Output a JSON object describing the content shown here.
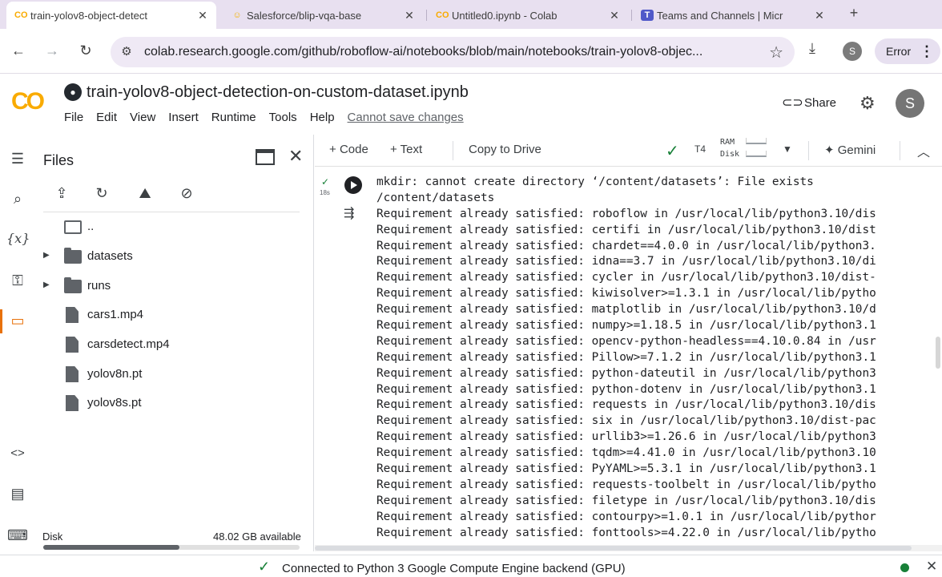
{
  "browser": {
    "tabs": [
      {
        "title": "train-yolov8-object-detect",
        "favicon": "colab-icon",
        "active": true
      },
      {
        "title": "Salesforce/blip-vqa-base",
        "favicon": "huggingface-icon",
        "active": false
      },
      {
        "title": "Untitled0.ipynb - Colab",
        "favicon": "colab-icon",
        "active": false
      },
      {
        "title": "Teams and Channels | Micr",
        "favicon": "teams-icon",
        "active": false
      }
    ],
    "url": "colab.research.google.com/github/roboflow-ai/notebooks/blob/main/notebooks/train-yolov8-objec...",
    "profile_initial": "S",
    "error_label": "Error"
  },
  "colab": {
    "logo_text": "CO",
    "notebook_title": "train-yolov8-object-detection-on-custom-dataset.ipynb",
    "menu": [
      "File",
      "Edit",
      "View",
      "Insert",
      "Runtime",
      "Tools",
      "Help"
    ],
    "unsaved_notice": "Cannot save changes",
    "share_label": "Share",
    "user_initial": "S"
  },
  "files_panel": {
    "title": "Files",
    "items": [
      {
        "name": "..",
        "type": "folder-up",
        "expandable": false
      },
      {
        "name": "datasets",
        "type": "folder",
        "expandable": true
      },
      {
        "name": "runs",
        "type": "folder",
        "expandable": true
      },
      {
        "name": "cars1.mp4",
        "type": "file",
        "expandable": false
      },
      {
        "name": "carsdetect.mp4",
        "type": "file",
        "expandable": false
      },
      {
        "name": "yolov8n.pt",
        "type": "file",
        "expandable": false
      },
      {
        "name": "yolov8s.pt",
        "type": "file",
        "expandable": false
      }
    ],
    "disk_label": "Disk",
    "disk_available": "48.02 GB available",
    "disk_used_fraction": 0.53
  },
  "toolbar": {
    "add_code": "Code",
    "add_text": "Text",
    "copy_to_drive": "Copy to Drive",
    "runtime_type": "T4",
    "ram_label": "RAM",
    "disk_label": "Disk",
    "gemini_label": "Gemini"
  },
  "cell": {
    "exec_time": "18s",
    "output_lines": [
      "mkdir: cannot create directory ‘/content/datasets’: File exists",
      "/content/datasets",
      "Requirement already satisfied: roboflow in /usr/local/lib/python3.10/dis",
      "Requirement already satisfied: certifi in /usr/local/lib/python3.10/dist",
      "Requirement already satisfied: chardet==4.0.0 in /usr/local/lib/python3.",
      "Requirement already satisfied: idna==3.7 in /usr/local/lib/python3.10/di",
      "Requirement already satisfied: cycler in /usr/local/lib/python3.10/dist-",
      "Requirement already satisfied: kiwisolver>=1.3.1 in /usr/local/lib/pytho",
      "Requirement already satisfied: matplotlib in /usr/local/lib/python3.10/d",
      "Requirement already satisfied: numpy>=1.18.5 in /usr/local/lib/python3.1",
      "Requirement already satisfied: opencv-python-headless==4.10.0.84 in /usr",
      "Requirement already satisfied: Pillow>=7.1.2 in /usr/local/lib/python3.1",
      "Requirement already satisfied: python-dateutil in /usr/local/lib/python3",
      "Requirement already satisfied: python-dotenv in /usr/local/lib/python3.1",
      "Requirement already satisfied: requests in /usr/local/lib/python3.10/dis",
      "Requirement already satisfied: six in /usr/local/lib/python3.10/dist-pac",
      "Requirement already satisfied: urllib3>=1.26.6 in /usr/local/lib/python3",
      "Requirement already satisfied: tqdm>=4.41.0 in /usr/local/lib/python3.10",
      "Requirement already satisfied: PyYAML>=5.3.1 in /usr/local/lib/python3.1",
      "Requirement already satisfied: requests-toolbelt in /usr/local/lib/pytho",
      "Requirement already satisfied: filetype in /usr/local/lib/python3.10/dis",
      "Requirement already satisfied: contourpy>=1.0.1 in /usr/local/lib/pythor",
      "Requirement already satisfied: fonttools>=4.22.0 in /usr/local/lib/pytho"
    ]
  },
  "status": {
    "message": "Connected to Python 3 Google Compute Engine backend (GPU)",
    "color": "#188038"
  },
  "colors": {
    "accent": "#e8710a",
    "colab_yellow": "#f9ab00",
    "success": "#188038"
  }
}
